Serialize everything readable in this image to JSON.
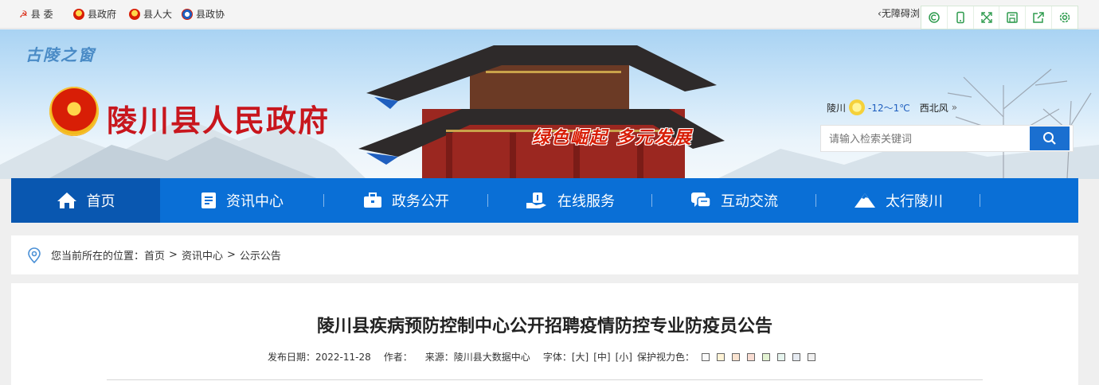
{
  "topbar": {
    "links": [
      "县 委",
      "县政府",
      "县人大",
      "县政协"
    ],
    "accessibility": "无障碍浏",
    "tools": [
      "refresh-icon",
      "mobile-icon",
      "expand-icon",
      "save-icon",
      "share-icon",
      "settings-icon"
    ]
  },
  "header": {
    "logo_text": "古陵之窗",
    "site_name": "陵川县人民政府",
    "slogan": "绿色崛起  多元发展",
    "weather": {
      "city": "陵川",
      "temp": "-12～1℃",
      "wind": "西北风",
      "more": "»"
    },
    "search": {
      "placeholder": "请输入检索关键词"
    }
  },
  "nav": {
    "items": [
      "首页",
      "资讯中心",
      "政务公开",
      "在线服务",
      "互动交流",
      "太行陵川"
    ],
    "active_index": 0
  },
  "breadcrumb": {
    "prefix": "您当前所在的位置：",
    "items": [
      "首页",
      "资讯中心",
      "公示公告"
    ],
    "separator": ">"
  },
  "article": {
    "title": "陵川县疾病预防控制中心公开招聘疫情防控专业防疫员公告",
    "meta": {
      "date_label": "发布日期：",
      "date": "2022-11-28",
      "author_label": "作者：",
      "source_label": "来源：",
      "source": "陵川县大数据中心",
      "font_label": "字体：",
      "font_sizes": [
        "[大]",
        "[中]",
        "[小]"
      ],
      "eye_label": "保护视力色："
    },
    "eye_colors": [
      "#fafafa",
      "#fff3d6",
      "#fae3d0",
      "#f8dcd2",
      "#e3f3d2",
      "#e6f4ee",
      "#e6ebf2",
      "#f0f0f0"
    ]
  },
  "colors": {
    "brand_blue": "#0a6fd6",
    "active_blue": "#0957b0",
    "red": "#c8161d"
  }
}
